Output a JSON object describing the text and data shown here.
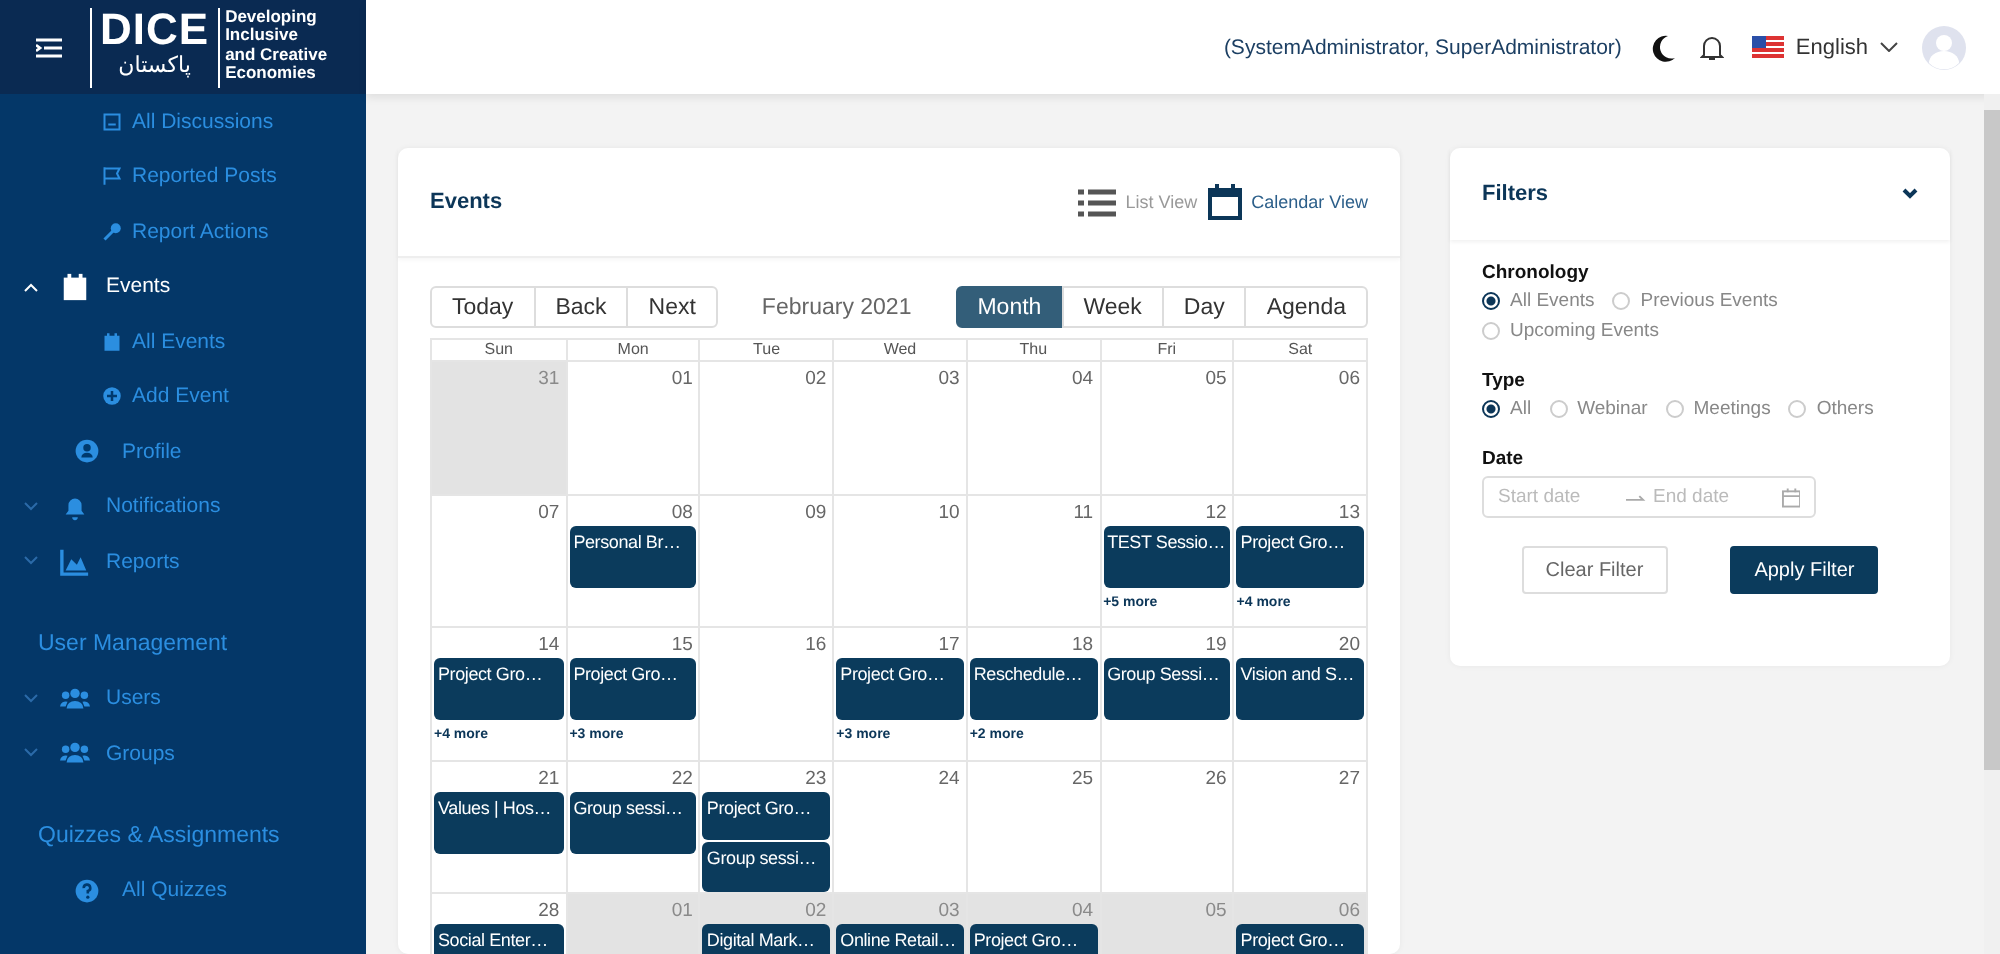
{
  "logo": {
    "title": "DICE",
    "subtitle": "پاکستان",
    "tagline": [
      "Developing",
      "Inclusive",
      "and Creative",
      "Economies"
    ]
  },
  "header": {
    "user": "(SystemAdministrator, SuperAdministrator)",
    "language": "English"
  },
  "sidebar": {
    "items": [
      {
        "kind": "sub",
        "label": "All Discussions",
        "selected": false
      },
      {
        "kind": "sub",
        "label": "Reported Posts",
        "selected": false
      },
      {
        "kind": "sub",
        "label": "Report Actions",
        "selected": false
      },
      {
        "kind": "group",
        "label": "Events",
        "expanded": true,
        "selected": true
      },
      {
        "kind": "sub",
        "label": "All Events",
        "selected": false
      },
      {
        "kind": "sub",
        "label": "Add Event",
        "selected": false
      },
      {
        "kind": "link",
        "label": "Profile",
        "selected": false
      },
      {
        "kind": "group",
        "label": "Notifications",
        "expanded": false,
        "selected": false
      },
      {
        "kind": "group",
        "label": "Reports",
        "expanded": false,
        "selected": false
      },
      {
        "kind": "heading",
        "label": "User Management"
      },
      {
        "kind": "group",
        "label": "Users",
        "expanded": false,
        "selected": false
      },
      {
        "kind": "group",
        "label": "Groups",
        "expanded": false,
        "selected": false
      },
      {
        "kind": "heading",
        "label": "Quizzes & Assignments"
      },
      {
        "kind": "link",
        "label": "All Quizzes",
        "selected": false
      }
    ]
  },
  "events": {
    "title": "Events",
    "views": [
      {
        "label": "List View",
        "selected": false
      },
      {
        "label": "Calendar View",
        "selected": true
      }
    ],
    "nav": [
      "Today",
      "Back",
      "Next"
    ],
    "period": "February 2021",
    "modes": [
      {
        "label": "Month",
        "selected": true
      },
      {
        "label": "Week",
        "selected": false
      },
      {
        "label": "Day",
        "selected": false
      },
      {
        "label": "Agenda",
        "selected": false
      }
    ],
    "weekdays": [
      "Sun",
      "Mon",
      "Tue",
      "Wed",
      "Thu",
      "Fri",
      "Sat"
    ],
    "weeks": [
      [
        {
          "day": "31",
          "off_range": true
        },
        {
          "day": "01",
          "off_range": false
        },
        {
          "day": "02",
          "off_range": false
        },
        {
          "day": "03",
          "off_range": false
        },
        {
          "day": "04",
          "off_range": false
        },
        {
          "day": "05",
          "off_range": false
        },
        {
          "day": "06",
          "off_range": false
        }
      ],
      [
        {
          "day": "07",
          "off_range": false
        },
        {
          "day": "08",
          "off_range": false,
          "events": [
            "Personal Br…"
          ]
        },
        {
          "day": "09",
          "off_range": false
        },
        {
          "day": "10",
          "off_range": false
        },
        {
          "day": "11",
          "off_range": false
        },
        {
          "day": "12",
          "off_range": false,
          "events": [
            "TEST Sessio…"
          ],
          "more": "+5 more"
        },
        {
          "day": "13",
          "off_range": false,
          "events": [
            "Project Gro…"
          ],
          "more": "+4 more"
        }
      ],
      [
        {
          "day": "14",
          "off_range": false,
          "events": [
            "Project Gro…"
          ],
          "more": "+4 more"
        },
        {
          "day": "15",
          "off_range": false,
          "events": [
            "Project Gro…"
          ],
          "more": "+3 more"
        },
        {
          "day": "16",
          "off_range": false
        },
        {
          "day": "17",
          "off_range": false,
          "events": [
            "Project Gro…"
          ],
          "more": "+3 more"
        },
        {
          "day": "18",
          "off_range": false,
          "events": [
            "Reschedule…"
          ],
          "more": "+2 more"
        },
        {
          "day": "19",
          "off_range": false,
          "events": [
            "Group Sessi…"
          ]
        },
        {
          "day": "20",
          "off_range": false,
          "events": [
            "Vision and S…"
          ]
        }
      ],
      [
        {
          "day": "21",
          "off_range": false,
          "events": [
            "Values | Hos…"
          ]
        },
        {
          "day": "22",
          "off_range": false,
          "events": [
            "Group sessi…"
          ]
        },
        {
          "day": "23",
          "off_range": false,
          "events": [
            "Project Gro…",
            "Group sessi…"
          ]
        },
        {
          "day": "24",
          "off_range": false
        },
        {
          "day": "25",
          "off_range": false
        },
        {
          "day": "26",
          "off_range": false
        },
        {
          "day": "27",
          "off_range": false
        }
      ],
      [
        {
          "day": "28",
          "off_range": false,
          "events": [
            "Social Enter…"
          ]
        },
        {
          "day": "01",
          "off_range": true
        },
        {
          "day": "02",
          "off_range": true,
          "events": [
            "Digital Mark…"
          ]
        },
        {
          "day": "03",
          "off_range": true,
          "events": [
            "Online Retail…"
          ]
        },
        {
          "day": "04",
          "off_range": true,
          "events": [
            "Project Gro…"
          ]
        },
        {
          "day": "05",
          "off_range": true
        },
        {
          "day": "06",
          "off_range": true,
          "events": [
            "Project Gro…"
          ]
        }
      ]
    ]
  },
  "filters": {
    "title": "Filters",
    "expanded": true,
    "chronology": {
      "label": "Chronology",
      "options": [
        {
          "label": "All Events",
          "selected": true
        },
        {
          "label": "Previous Events",
          "selected": false
        },
        {
          "label": "Upcoming Events",
          "selected": false
        }
      ]
    },
    "type": {
      "label": "Type",
      "options": [
        {
          "label": "All",
          "selected": true
        },
        {
          "label": "Webinar",
          "selected": false
        },
        {
          "label": "Meetings",
          "selected": false
        },
        {
          "label": "Others",
          "selected": false
        }
      ]
    },
    "date": {
      "label": "Date",
      "start_placeholder": "Start date",
      "end_placeholder": "End date"
    },
    "buttons": [
      {
        "kind": "secondary",
        "label": "Clear Filter"
      },
      {
        "kind": "primary",
        "label": "Apply Filter"
      }
    ]
  }
}
